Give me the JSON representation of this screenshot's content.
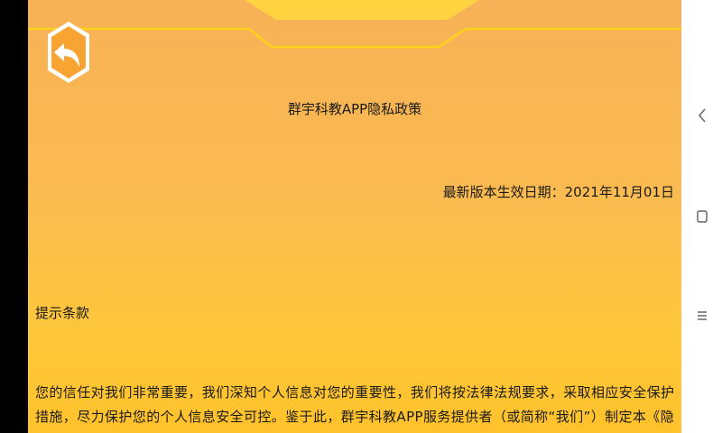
{
  "app": {
    "title": "群宇科教APP隐私政策",
    "effective_date": "最新版本生效日期：2021年11月01日",
    "section_title": "提示条款",
    "body_text": "您的信任对我们非常重要，我们深知个人信息对您的重要性，我们将按法律法规要求，采取相应安全保护措施，尽力保护您的个人信息安全可控。鉴于此，群宇科教APP服务提供者（或简称“我们”）制定本《隐私权"
  },
  "icons": {
    "back": "back-arrow-icon",
    "nav_back": "chevron-left-icon",
    "nav_home": "square-icon",
    "nav_menu": "three-lines-icon"
  },
  "colors": {
    "background_top": "#f8b157",
    "background_bottom": "#ffc22b",
    "accent_line": "#ffd21a",
    "back_button_fill": "#f7a433",
    "text": "#1a1a1a"
  }
}
